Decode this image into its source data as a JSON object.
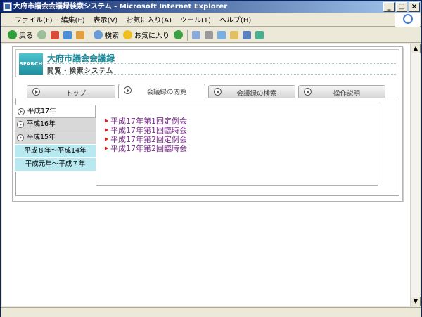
{
  "window": {
    "title": "大府市議会会議録検索システム - Microsoft Internet Explorer",
    "controls": [
      "_",
      "□",
      "×"
    ]
  },
  "menu": [
    "ファイル(F)",
    "編集(E)",
    "表示(V)",
    "お気に入り(A)",
    "ツール(T)",
    "ヘルプ(H)"
  ],
  "toolbar": {
    "back": "戻る",
    "search": "検索",
    "favorites": "お気に入り"
  },
  "header": {
    "logo": "SEARCH",
    "title": "大府市議会会議録",
    "subtitle": "閲覧・検索システム"
  },
  "tabs": [
    {
      "label": "トップ"
    },
    {
      "label": "会議録の閲覧"
    },
    {
      "label": "会議録の検索"
    },
    {
      "label": "操作説明"
    }
  ],
  "years": [
    {
      "label": "平成17年"
    },
    {
      "label": "平成16年"
    },
    {
      "label": "平成15年"
    },
    {
      "label": "平成８年～平成14年"
    },
    {
      "label": "平成元年～平成７年"
    }
  ],
  "meetings": [
    "平成17年第1回定例会",
    "平成17年第1回臨時会",
    "平成17年第2回定例会",
    "平成17年第2回臨時会"
  ],
  "colors": {
    "accent": "#1a8a9a",
    "link": "#7a2c8a",
    "bullet": "#e02020",
    "range_bg": "#b8e8f0"
  }
}
